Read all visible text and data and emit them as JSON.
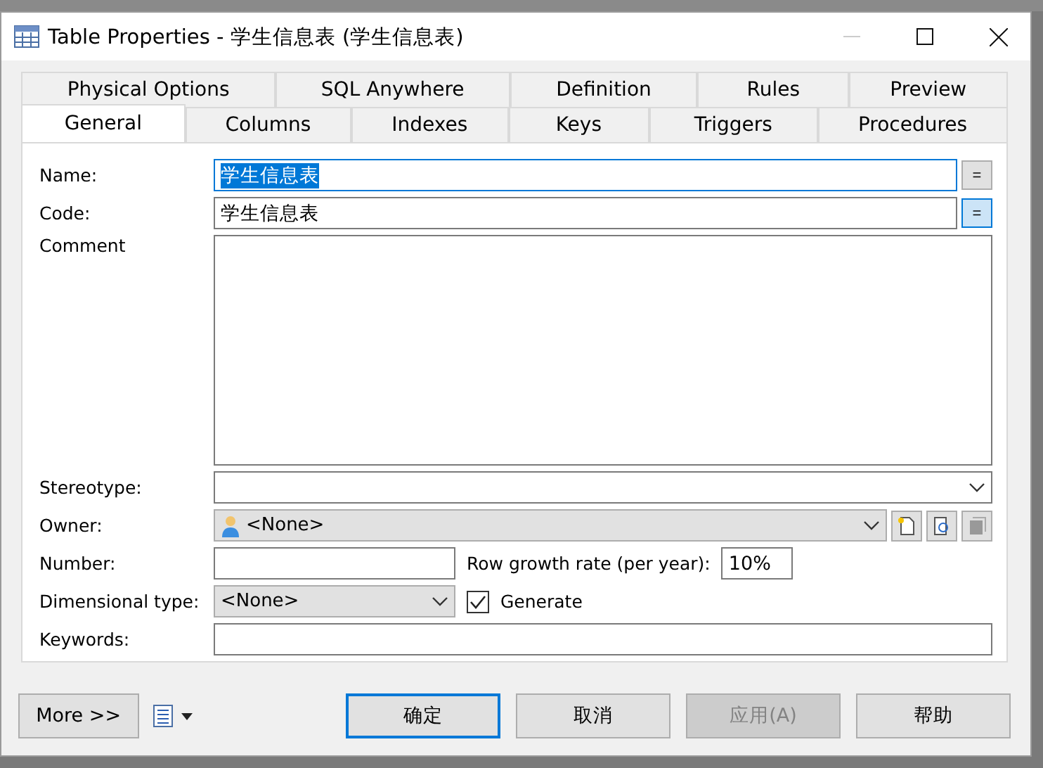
{
  "window": {
    "title": "Table Properties - 学生信息表 (学生信息表)"
  },
  "tab_rows": [
    {
      "tabs": [
        {
          "label": "Physical Options",
          "selected": false
        },
        {
          "label": "SQL Anywhere",
          "selected": false
        },
        {
          "label": "Definition",
          "selected": false
        },
        {
          "label": "Rules",
          "selected": false
        },
        {
          "label": "Preview",
          "selected": false
        }
      ]
    },
    {
      "tabs": [
        {
          "label": "General",
          "selected": true
        },
        {
          "label": "Columns",
          "selected": false
        },
        {
          "label": "Indexes",
          "selected": false
        },
        {
          "label": "Keys",
          "selected": false
        },
        {
          "label": "Triggers",
          "selected": false
        },
        {
          "label": "Procedures",
          "selected": false
        }
      ]
    }
  ],
  "name": {
    "label": "Name:",
    "value": "学生信息表",
    "highlighted": true,
    "equals_button": {
      "label": "=",
      "pressed": false
    }
  },
  "code": {
    "label": "Code:",
    "value": "学生信息表",
    "highlighted": false,
    "equals_button": {
      "label": "=",
      "pressed": true
    }
  },
  "comment": {
    "label": "Comment"
  },
  "stereotype": {
    "label": "Stereotype:"
  },
  "owner": {
    "label": "Owner:",
    "value": "<None>"
  },
  "number": {
    "label": "Number:"
  },
  "row_growth": {
    "label": "Row growth rate (per year):",
    "value": "10%"
  },
  "dimensional_type": {
    "label": "Dimensional type:",
    "value": "<None>"
  },
  "generate": {
    "label": "Generate",
    "checked": true
  },
  "keywords": {
    "label": "Keywords:"
  },
  "buttons": [
    {
      "label": "More >>",
      "kind": "plain",
      "disabled": false
    },
    {
      "label": "确定",
      "kind": "default",
      "disabled": false
    },
    {
      "label": "取消",
      "kind": "plain",
      "disabled": false
    },
    {
      "label": "应用(A)",
      "kind": "plain",
      "disabled": true
    },
    {
      "label": "帮助",
      "kind": "plain",
      "disabled": false
    }
  ]
}
